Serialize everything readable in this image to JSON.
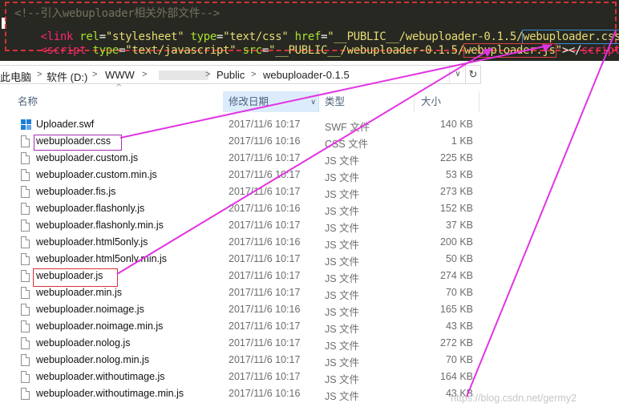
{
  "code": {
    "line1": "<!--引入webuploader相关外部文件-->",
    "line2": {
      "open": "<link",
      "rel_attr": " rel",
      "eq1": "=",
      "rel_val": "\"stylesheet\"",
      "type_attr": " type",
      "eq2": "=",
      "type_val": "\"text/css\"",
      "href_attr": " href",
      "eq3": "=",
      "href_prefix": "\"__PUBLIC__/webuploader-0.1.5/",
      "href_file": "webuploader.css",
      "href_end": "\"",
      "close": ">"
    },
    "line3": {
      "open": "<script",
      "type_attr": " type",
      "eq1": "=",
      "type_val": "\"text/javascript\"",
      "src_attr": " src",
      "eq2": "=",
      "src_prefix": "\"__PUBLIC__/webuploader-0.1.5/",
      "src_file": "webuploader.js",
      "src_end": "\"",
      "mid": "></",
      "close_tag": "script",
      "close": ">"
    }
  },
  "address": {
    "this_pc": "此电脑",
    "drive": "软件 (D:)",
    "www": "WWW",
    "public": "Public",
    "folder": "webuploader-0.1.5",
    "sep": ">",
    "dropdown": "∨",
    "refresh": "↻"
  },
  "columns": {
    "name": "名称",
    "date": "修改日期",
    "type": "类型",
    "size": "大小",
    "date_chevron": "∨",
    "sort_arrow": "^"
  },
  "files": [
    {
      "name": "Uploader.swf",
      "date": "2017/11/6 10:17",
      "type": "SWF 文件",
      "size": "140 KB",
      "icon": "swf-icon"
    },
    {
      "name": "webuploader.css",
      "date": "2017/11/6 10:16",
      "type": "CSS 文件",
      "size": "1 KB",
      "icon": "file-icon"
    },
    {
      "name": "webuploader.custom.js",
      "date": "2017/11/6 10:17",
      "type": "JS 文件",
      "size": "225 KB",
      "icon": "file-icon"
    },
    {
      "name": "webuploader.custom.min.js",
      "date": "2017/11/6 10:17",
      "type": "JS 文件",
      "size": "53 KB",
      "icon": "file-icon"
    },
    {
      "name": "webuploader.fis.js",
      "date": "2017/11/6 10:17",
      "type": "JS 文件",
      "size": "273 KB",
      "icon": "file-icon"
    },
    {
      "name": "webuploader.flashonly.js",
      "date": "2017/11/6 10:16",
      "type": "JS 文件",
      "size": "152 KB",
      "icon": "file-icon"
    },
    {
      "name": "webuploader.flashonly.min.js",
      "date": "2017/11/6 10:17",
      "type": "JS 文件",
      "size": "37 KB",
      "icon": "file-icon"
    },
    {
      "name": "webuploader.html5only.js",
      "date": "2017/11/6 10:16",
      "type": "JS 文件",
      "size": "200 KB",
      "icon": "file-icon"
    },
    {
      "name": "webuploader.html5only.min.js",
      "date": "2017/11/6 10:17",
      "type": "JS 文件",
      "size": "50 KB",
      "icon": "file-icon"
    },
    {
      "name": "webuploader.js",
      "date": "2017/11/6 10:17",
      "type": "JS 文件",
      "size": "274 KB",
      "icon": "file-icon"
    },
    {
      "name": "webuploader.min.js",
      "date": "2017/11/6 10:17",
      "type": "JS 文件",
      "size": "70 KB",
      "icon": "file-icon"
    },
    {
      "name": "webuploader.noimage.js",
      "date": "2017/11/6 10:16",
      "type": "JS 文件",
      "size": "165 KB",
      "icon": "file-icon"
    },
    {
      "name": "webuploader.noimage.min.js",
      "date": "2017/11/6 10:17",
      "type": "JS 文件",
      "size": "43 KB",
      "icon": "file-icon"
    },
    {
      "name": "webuploader.nolog.js",
      "date": "2017/11/6 10:17",
      "type": "JS 文件",
      "size": "272 KB",
      "icon": "file-icon"
    },
    {
      "name": "webuploader.nolog.min.js",
      "date": "2017/11/6 10:17",
      "type": "JS 文件",
      "size": "70 KB",
      "icon": "file-icon"
    },
    {
      "name": "webuploader.withoutimage.js",
      "date": "2017/11/6 10:17",
      "type": "JS 文件",
      "size": "164 KB",
      "icon": "file-icon"
    },
    {
      "name": "webuploader.withoutimage.min.js",
      "date": "2017/11/6 10:16",
      "type": "JS 文件",
      "size": "43 KB",
      "icon": "file-icon"
    }
  ],
  "watermark": "https://blog.csdn.net/germy2",
  "colors": {
    "arrow": "#e234e2",
    "highlight_css": "#a52fb3",
    "highlight_js": "#d8303a",
    "code_bg": "#272822",
    "selected_column": "#dcecfc"
  }
}
